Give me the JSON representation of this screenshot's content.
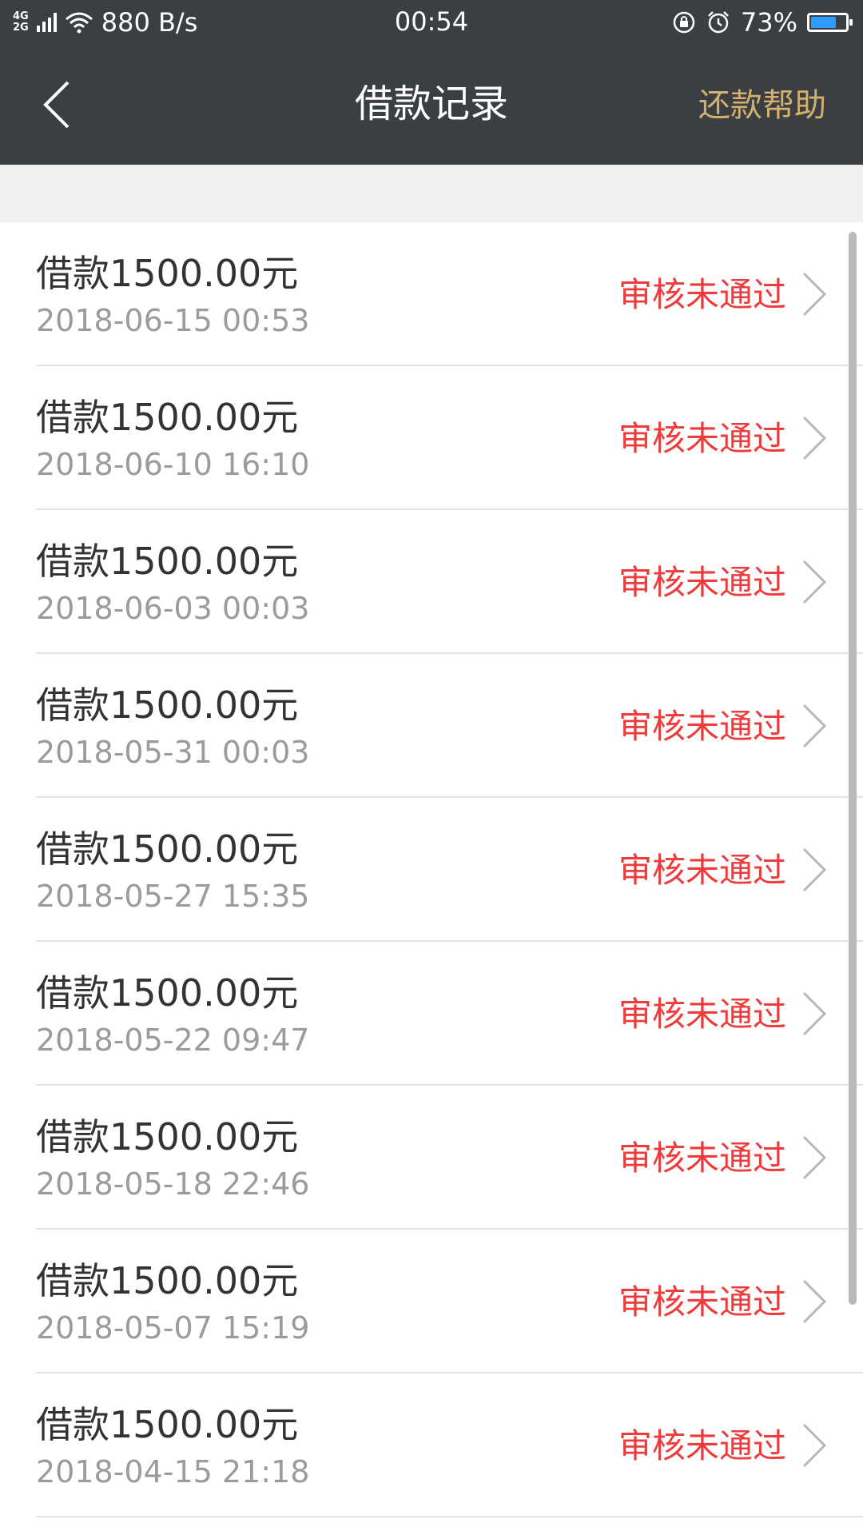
{
  "status_bar": {
    "network_top": "4G",
    "network_bottom": "2G",
    "speed": "880 B/s",
    "time": "00:54",
    "battery": "73%",
    "battery_level": 0.73,
    "battery_color": "#2e9bff"
  },
  "nav": {
    "title": "借款记录",
    "help": "还款帮助"
  },
  "records": [
    {
      "amount": "借款1500.00元",
      "date": "2018-06-15 00:53",
      "status": "审核未通过"
    },
    {
      "amount": "借款1500.00元",
      "date": "2018-06-10 16:10",
      "status": "审核未通过"
    },
    {
      "amount": "借款1500.00元",
      "date": "2018-06-03 00:03",
      "status": "审核未通过"
    },
    {
      "amount": "借款1500.00元",
      "date": "2018-05-31 00:03",
      "status": "审核未通过"
    },
    {
      "amount": "借款1500.00元",
      "date": "2018-05-27 15:35",
      "status": "审核未通过"
    },
    {
      "amount": "借款1500.00元",
      "date": "2018-05-22 09:47",
      "status": "审核未通过"
    },
    {
      "amount": "借款1500.00元",
      "date": "2018-05-18 22:46",
      "status": "审核未通过"
    },
    {
      "amount": "借款1500.00元",
      "date": "2018-05-07 15:19",
      "status": "审核未通过"
    },
    {
      "amount": "借款1500.00元",
      "date": "2018-04-15 21:18",
      "status": "审核未通过"
    }
  ],
  "colors": {
    "header_bg": "#3b3f44",
    "help_gold": "#d3b06b",
    "status_red": "#ee3b3b"
  }
}
